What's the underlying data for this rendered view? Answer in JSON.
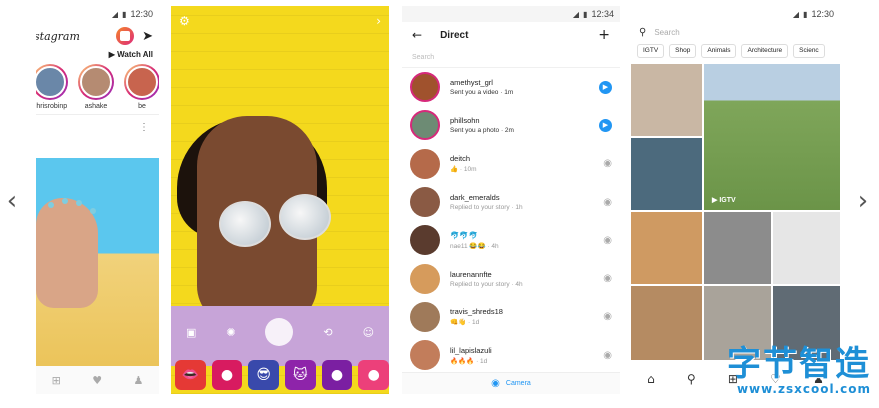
{
  "gallery": {
    "prev_arrow": "‹",
    "next_arrow": "›"
  },
  "status_bar": {
    "time_1": "12:30",
    "time_3": "12:34",
    "time_4": "12:30",
    "signal": "◢",
    "battery": "▮"
  },
  "feed": {
    "logo": "stagram",
    "watch_all": "▶ Watch All",
    "stories": [
      {
        "name": "chrisrobinp"
      },
      {
        "name": "ashake"
      },
      {
        "name": "be"
      }
    ],
    "more": "⋮",
    "nav_icons": [
      "add-icon",
      "heart-icon",
      "profile-icon"
    ],
    "nav_glyphs": [
      "⊞",
      "♥",
      "♟"
    ]
  },
  "camera": {
    "controls": [
      "▣",
      "✺",
      "⟲",
      "☺"
    ],
    "filters": [
      "👄",
      "●",
      "😎",
      "🐱",
      "●",
      "●"
    ],
    "filter_colors": [
      "#e53935",
      "#d81b60",
      "#3949ab",
      "#8e24aa",
      "#7b1fa2",
      "#ec407a"
    ]
  },
  "direct": {
    "title": "Direct",
    "back": "←",
    "plus": "+",
    "search_placeholder": "Search",
    "threads": [
      {
        "name": "amethyst_grl",
        "sub": "Sent you a video · 1m",
        "unread": true,
        "color": "#a0522d"
      },
      {
        "name": "phillsohn",
        "sub": "Sent you a photo · 2m",
        "unread": true,
        "color": "#6d8b74"
      },
      {
        "name": "deitch",
        "sub": "👍 · 10m",
        "unread": false,
        "color": "#b56a4a"
      },
      {
        "name": "dark_emeralds",
        "sub": "Replied to your story · 1h",
        "unread": false,
        "color": "#8a5a44"
      },
      {
        "name": "🐬🐬🐬",
        "sub": "nae11 😂😂 · 4h",
        "unread": false,
        "color": "#5a3b2e"
      },
      {
        "name": "laurenannfte",
        "sub": "Replied to your story · 4h",
        "unread": false,
        "color": "#d69b5c"
      },
      {
        "name": "travis_shreds18",
        "sub": "👊👋 · 1d",
        "unread": false,
        "color": "#9f7a5a"
      },
      {
        "name": "lil_lapislazuli",
        "sub": "🔥🔥🔥 · 1d",
        "unread": false,
        "color": "#c27d5b"
      }
    ],
    "send_icon": "▶",
    "camera_icon": "◉",
    "camera_label": "Camera"
  },
  "explore": {
    "search_placeholder": "Search",
    "chips": [
      "IGTV",
      "Shop",
      "Animals",
      "Architecture",
      "Scienc"
    ],
    "igtv_badge": "▶ IGTV",
    "tiles": [
      "#c9b7a4",
      "#7fa65a",
      "#4c6a7d",
      "#cf9a62",
      "#8c8c8c",
      "#e6e6e6",
      "#b58b62",
      "#a9a39a",
      "#606b74"
    ],
    "nav_glyphs": [
      "⌂",
      "⚲",
      "⊞",
      "♡",
      "♟"
    ]
  },
  "watermark": {
    "title": "字节智造",
    "url": "www.zsxcool.com"
  }
}
